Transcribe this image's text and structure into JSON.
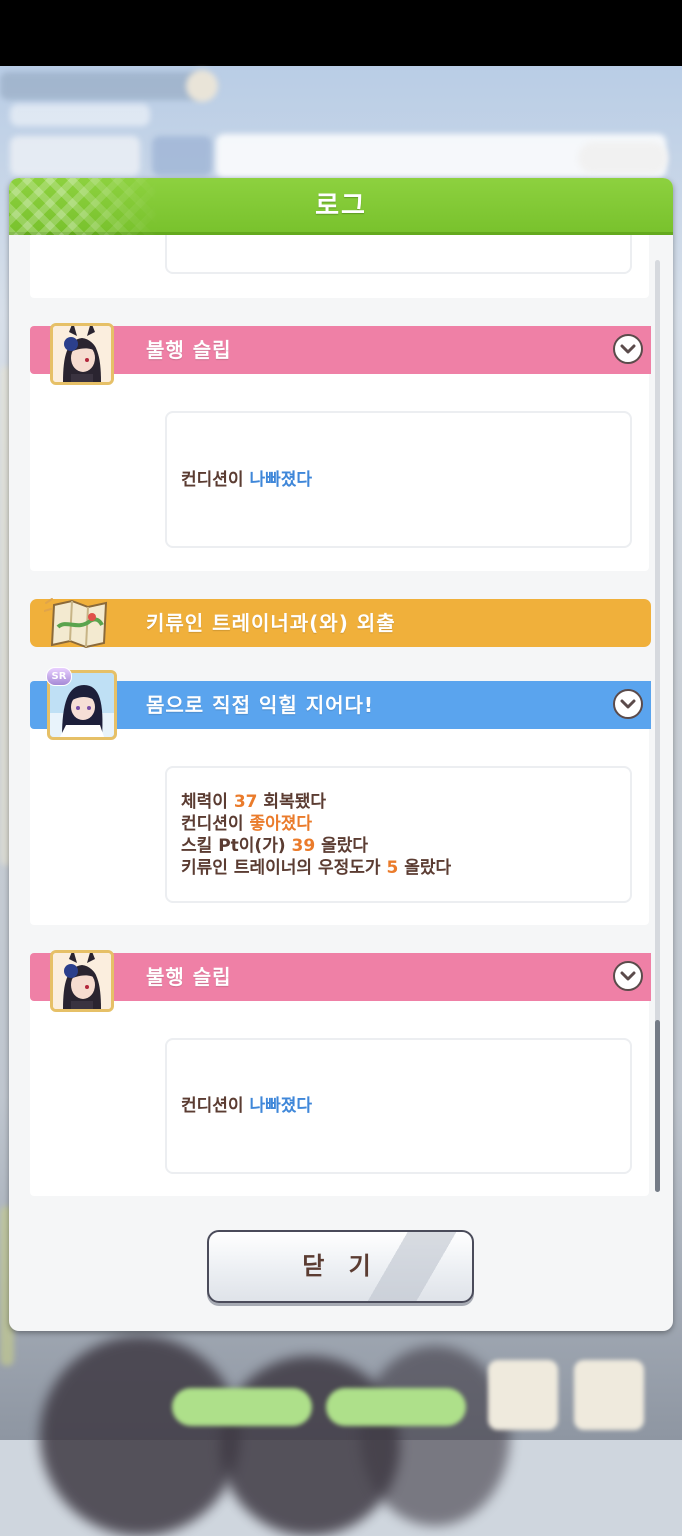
{
  "dialog": {
    "title": "로그",
    "close_label": "닫 기"
  },
  "log": {
    "entries": [
      {
        "kind": "event",
        "color": "#ef80a6",
        "title": "불행 슬립",
        "portrait": "horse-girl-portrait-icon",
        "result": {
          "prefix": "컨디션이 ",
          "value": "나빠졌다"
        }
      },
      {
        "kind": "outing",
        "color": "#f0b03b",
        "title": "키류인 트레이너과(와) 외출",
        "icon": "map-icon"
      },
      {
        "kind": "event",
        "color": "#5aa4ee",
        "title": "몸으로 직접 익힐 지어다!",
        "portrait": "support-card-portrait-icon",
        "badge": "SR",
        "results": [
          {
            "prefix": "체력이 ",
            "value": "37",
            "suffix": " 회복됐다"
          },
          {
            "prefix": "컨디션이 ",
            "value": "좋아졌다",
            "suffix": ""
          },
          {
            "prefix": "스킬 Pt이(가) ",
            "value": "39",
            "suffix": " 올랐다"
          },
          {
            "prefix": "키류인 트레이너의 우정도가 ",
            "value": "5",
            "suffix": " 올랐다"
          }
        ]
      },
      {
        "kind": "event",
        "color": "#ef80a6",
        "title": "불행 슬립",
        "portrait": "horse-girl-portrait-icon",
        "result": {
          "prefix": "컨디션이 ",
          "value": "나빠졌다"
        }
      }
    ]
  },
  "colors": {
    "header_green": "#79c22d",
    "highlight_good": "#ea7b2b",
    "highlight_bad": "#3f87d9",
    "text_brown": "#5b3c32"
  }
}
